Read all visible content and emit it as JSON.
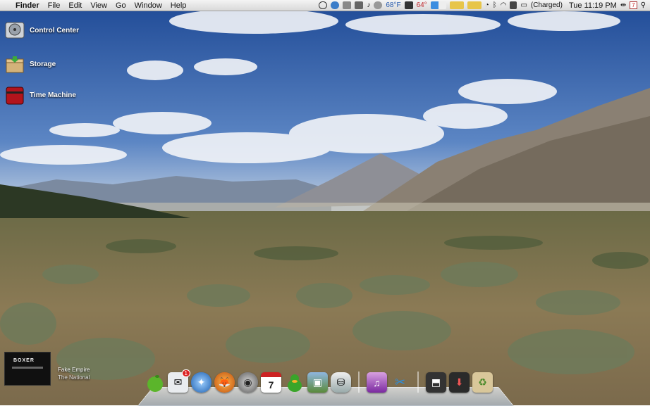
{
  "menubar": {
    "app_name": "Finder",
    "menus": [
      "File",
      "Edit",
      "View",
      "Go",
      "Window",
      "Help"
    ],
    "status": {
      "weather_f": "68°F",
      "temp_c": "64°",
      "battery": "(Charged)",
      "clock": "Tue 11:19 PM",
      "calendar_day": "7"
    }
  },
  "desktop_icons": [
    {
      "label": "Control Center",
      "icon": "hard-drive-icon"
    },
    {
      "label": "Storage",
      "icon": "archive-box-icon"
    },
    {
      "label": "Time Machine",
      "icon": "time-machine-drive-icon"
    }
  ],
  "now_playing": {
    "title": "Fake Empire",
    "artist": "The National",
    "cover_text": "BOXER"
  },
  "dock": {
    "mail_badge": "1",
    "calendar_day": "7",
    "items": [
      "finder",
      "mail",
      "safari",
      "firefox",
      "quicktime",
      "calendar",
      "adium",
      "iphoto",
      "disk-utility",
      "itunes",
      "scripts",
      "installer",
      "downloads",
      "trash"
    ]
  },
  "colors": {
    "sky_top": "#2e5aa8",
    "accent_dock": "#c9d2da"
  }
}
